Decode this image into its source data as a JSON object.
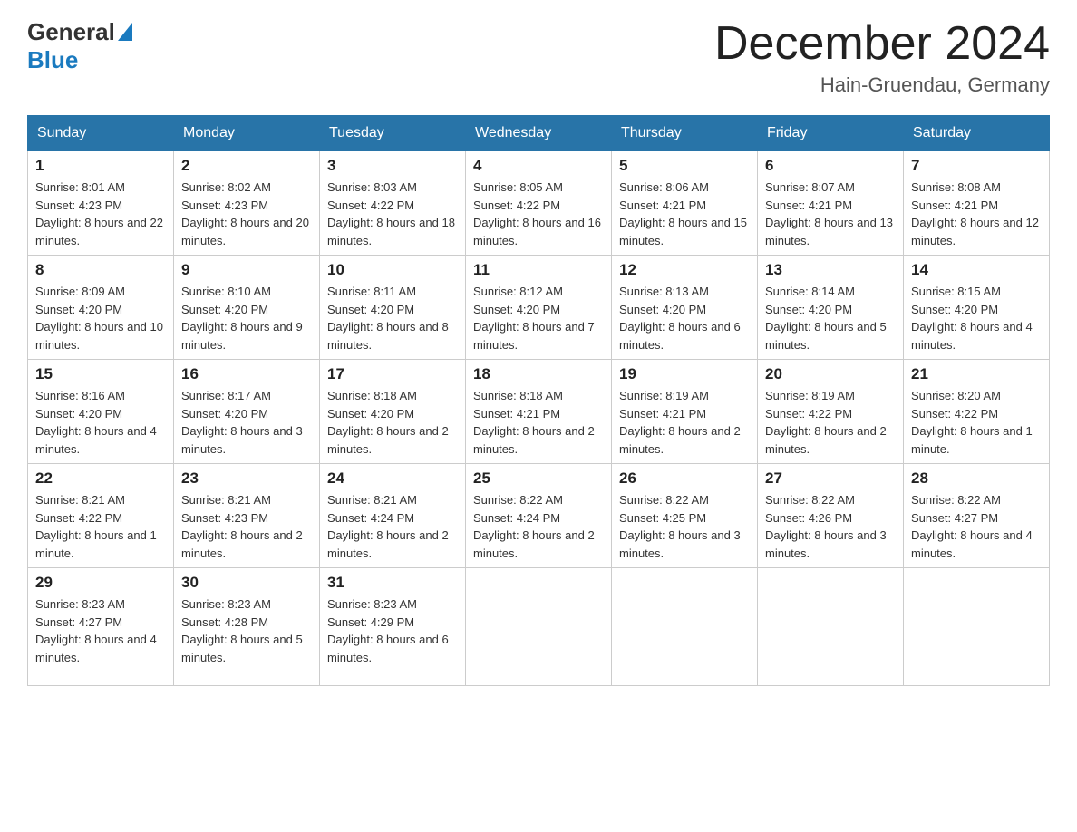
{
  "header": {
    "logo_general": "General",
    "logo_blue": "Blue",
    "month_title": "December 2024",
    "location": "Hain-Gruendau, Germany"
  },
  "calendar": {
    "days_of_week": [
      "Sunday",
      "Monday",
      "Tuesday",
      "Wednesday",
      "Thursday",
      "Friday",
      "Saturday"
    ],
    "weeks": [
      [
        {
          "day": "1",
          "sunrise": "8:01 AM",
          "sunset": "4:23 PM",
          "daylight": "8 hours and 22 minutes."
        },
        {
          "day": "2",
          "sunrise": "8:02 AM",
          "sunset": "4:23 PM",
          "daylight": "8 hours and 20 minutes."
        },
        {
          "day": "3",
          "sunrise": "8:03 AM",
          "sunset": "4:22 PM",
          "daylight": "8 hours and 18 minutes."
        },
        {
          "day": "4",
          "sunrise": "8:05 AM",
          "sunset": "4:22 PM",
          "daylight": "8 hours and 16 minutes."
        },
        {
          "day": "5",
          "sunrise": "8:06 AM",
          "sunset": "4:21 PM",
          "daylight": "8 hours and 15 minutes."
        },
        {
          "day": "6",
          "sunrise": "8:07 AM",
          "sunset": "4:21 PM",
          "daylight": "8 hours and 13 minutes."
        },
        {
          "day": "7",
          "sunrise": "8:08 AM",
          "sunset": "4:21 PM",
          "daylight": "8 hours and 12 minutes."
        }
      ],
      [
        {
          "day": "8",
          "sunrise": "8:09 AM",
          "sunset": "4:20 PM",
          "daylight": "8 hours and 10 minutes."
        },
        {
          "day": "9",
          "sunrise": "8:10 AM",
          "sunset": "4:20 PM",
          "daylight": "8 hours and 9 minutes."
        },
        {
          "day": "10",
          "sunrise": "8:11 AM",
          "sunset": "4:20 PM",
          "daylight": "8 hours and 8 minutes."
        },
        {
          "day": "11",
          "sunrise": "8:12 AM",
          "sunset": "4:20 PM",
          "daylight": "8 hours and 7 minutes."
        },
        {
          "day": "12",
          "sunrise": "8:13 AM",
          "sunset": "4:20 PM",
          "daylight": "8 hours and 6 minutes."
        },
        {
          "day": "13",
          "sunrise": "8:14 AM",
          "sunset": "4:20 PM",
          "daylight": "8 hours and 5 minutes."
        },
        {
          "day": "14",
          "sunrise": "8:15 AM",
          "sunset": "4:20 PM",
          "daylight": "8 hours and 4 minutes."
        }
      ],
      [
        {
          "day": "15",
          "sunrise": "8:16 AM",
          "sunset": "4:20 PM",
          "daylight": "8 hours and 4 minutes."
        },
        {
          "day": "16",
          "sunrise": "8:17 AM",
          "sunset": "4:20 PM",
          "daylight": "8 hours and 3 minutes."
        },
        {
          "day": "17",
          "sunrise": "8:18 AM",
          "sunset": "4:20 PM",
          "daylight": "8 hours and 2 minutes."
        },
        {
          "day": "18",
          "sunrise": "8:18 AM",
          "sunset": "4:21 PM",
          "daylight": "8 hours and 2 minutes."
        },
        {
          "day": "19",
          "sunrise": "8:19 AM",
          "sunset": "4:21 PM",
          "daylight": "8 hours and 2 minutes."
        },
        {
          "day": "20",
          "sunrise": "8:19 AM",
          "sunset": "4:22 PM",
          "daylight": "8 hours and 2 minutes."
        },
        {
          "day": "21",
          "sunrise": "8:20 AM",
          "sunset": "4:22 PM",
          "daylight": "8 hours and 1 minute."
        }
      ],
      [
        {
          "day": "22",
          "sunrise": "8:21 AM",
          "sunset": "4:22 PM",
          "daylight": "8 hours and 1 minute."
        },
        {
          "day": "23",
          "sunrise": "8:21 AM",
          "sunset": "4:23 PM",
          "daylight": "8 hours and 2 minutes."
        },
        {
          "day": "24",
          "sunrise": "8:21 AM",
          "sunset": "4:24 PM",
          "daylight": "8 hours and 2 minutes."
        },
        {
          "day": "25",
          "sunrise": "8:22 AM",
          "sunset": "4:24 PM",
          "daylight": "8 hours and 2 minutes."
        },
        {
          "day": "26",
          "sunrise": "8:22 AM",
          "sunset": "4:25 PM",
          "daylight": "8 hours and 3 minutes."
        },
        {
          "day": "27",
          "sunrise": "8:22 AM",
          "sunset": "4:26 PM",
          "daylight": "8 hours and 3 minutes."
        },
        {
          "day": "28",
          "sunrise": "8:22 AM",
          "sunset": "4:27 PM",
          "daylight": "8 hours and 4 minutes."
        }
      ],
      [
        {
          "day": "29",
          "sunrise": "8:23 AM",
          "sunset": "4:27 PM",
          "daylight": "8 hours and 4 minutes."
        },
        {
          "day": "30",
          "sunrise": "8:23 AM",
          "sunset": "4:28 PM",
          "daylight": "8 hours and 5 minutes."
        },
        {
          "day": "31",
          "sunrise": "8:23 AM",
          "sunset": "4:29 PM",
          "daylight": "8 hours and 6 minutes."
        },
        null,
        null,
        null,
        null
      ]
    ]
  }
}
